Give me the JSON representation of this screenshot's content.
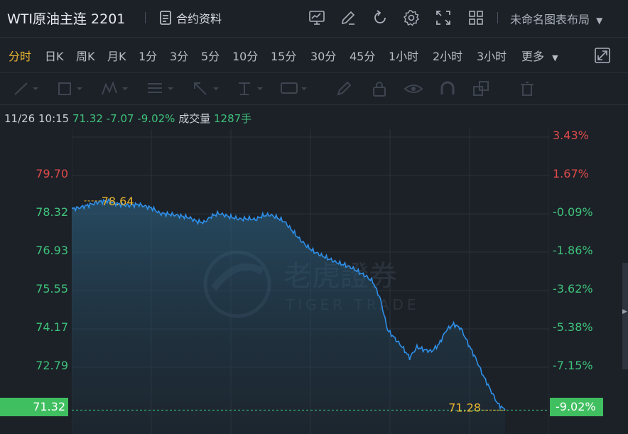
{
  "header": {
    "title": "WTI原油主连 2201",
    "contract_label": "合约资料",
    "layout_label": "未命名图表布局"
  },
  "periods": [
    "分时",
    "日K",
    "周K",
    "月K",
    "1分",
    "3分",
    "5分",
    "10分",
    "15分",
    "30分",
    "45分",
    "1小时",
    "2小时",
    "3小时",
    "更多"
  ],
  "active_period": "分时",
  "info": {
    "datetime": "11/26 10:15",
    "price": "71.32",
    "change": "-7.07",
    "change_pct": "-9.02%",
    "volume_label": "成交量",
    "volume": "1287手"
  },
  "watermark": {
    "cn": "老虎證券",
    "en": "TIGER TRADE"
  },
  "colors": {
    "up": "#e04a4a",
    "down": "#3fc27a",
    "line": "#2f8fe8",
    "accent": "#e9b531",
    "tag": "#3fbf5f"
  },
  "chart_data": {
    "type": "area",
    "ylim": [
      70.44,
      81.16
    ],
    "prev_close": 78.39,
    "left_ticks": [
      "79.70",
      "78.32",
      "76.93",
      "75.55",
      "74.17",
      "72.79"
    ],
    "right_ticks": [
      "3.43%",
      "1.67%",
      "-0.09%",
      "-1.86%",
      "-3.62%",
      "-5.38%",
      "-7.15%"
    ],
    "current_left_tag": "71.32",
    "current_right_tag": "-9.02%",
    "max_label": "78.64",
    "min_label": "71.28",
    "y": [
      78.36,
      78.4,
      78.47,
      78.55,
      78.62,
      78.64,
      78.55,
      78.5,
      78.48,
      78.52,
      78.45,
      78.38,
      78.2,
      78.18,
      78.15,
      78.1,
      78.05,
      77.92,
      77.88,
      78.1,
      78.2,
      78.12,
      78.05,
      78.0,
      78.02,
      77.98,
      78.12,
      78.15,
      78.05,
      77.9,
      77.6,
      77.3,
      77.05,
      76.85,
      76.72,
      76.6,
      76.48,
      76.4,
      76.3,
      76.15,
      76.0,
      75.8,
      75.2,
      74.1,
      73.8,
      73.5,
      73.12,
      73.5,
      73.4,
      73.35,
      73.6,
      74.1,
      74.3,
      74.15,
      73.6,
      73.1,
      72.5,
      72.0,
      71.5,
      71.28
    ]
  }
}
